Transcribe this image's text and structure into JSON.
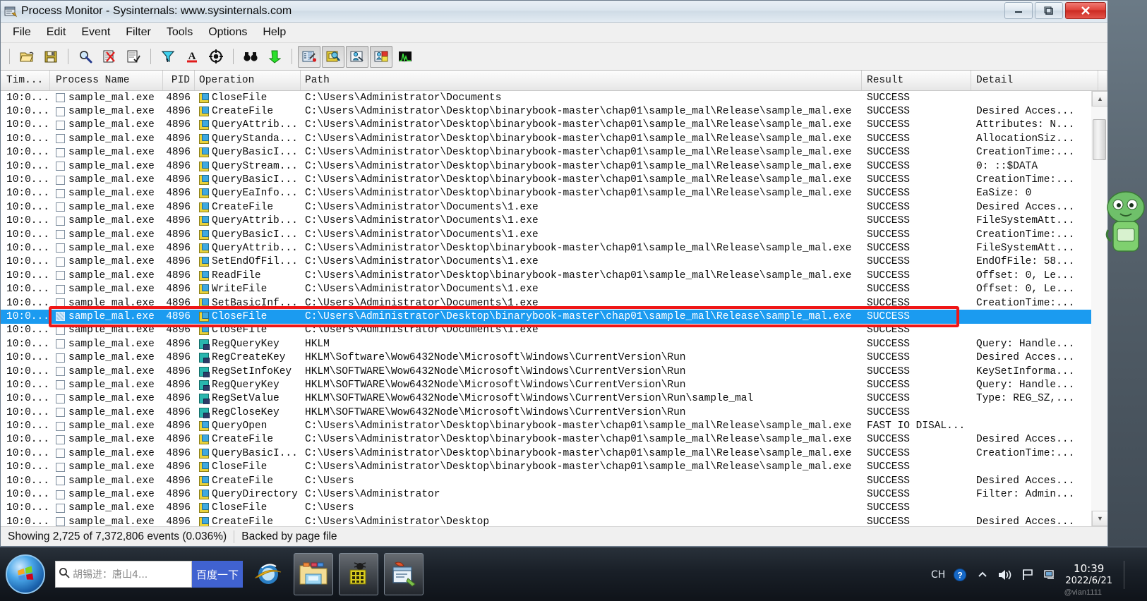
{
  "window": {
    "title": "Process Monitor - Sysinternals: www.sysinternals.com",
    "icon": "procmon-icon",
    "minimize": "–",
    "maximize": "❐",
    "close": "✕"
  },
  "menubar": [
    {
      "label": "File"
    },
    {
      "label": "Edit"
    },
    {
      "label": "Event"
    },
    {
      "label": "Filter"
    },
    {
      "label": "Tools"
    },
    {
      "label": "Options"
    },
    {
      "label": "Help"
    }
  ],
  "toolbar": [
    {
      "name": "open-icon",
      "pressed": false
    },
    {
      "name": "save-icon",
      "pressed": false
    },
    {
      "name": "separator"
    },
    {
      "name": "capture-events-icon",
      "pressed": false
    },
    {
      "name": "autoscroll-icon",
      "pressed": false
    },
    {
      "name": "clear-display-icon",
      "pressed": false
    },
    {
      "name": "separator"
    },
    {
      "name": "filter-icon",
      "pressed": false
    },
    {
      "name": "highlight-icon",
      "pressed": false
    },
    {
      "name": "include-process-icon",
      "pressed": false
    },
    {
      "name": "separator"
    },
    {
      "name": "find-icon",
      "pressed": false
    },
    {
      "name": "jump-to-icon",
      "pressed": false
    },
    {
      "name": "separator"
    },
    {
      "name": "show-registry-activity-icon",
      "pressed": true
    },
    {
      "name": "show-file-activity-icon",
      "pressed": true
    },
    {
      "name": "show-network-activity-icon",
      "pressed": true
    },
    {
      "name": "show-process-activity-icon",
      "pressed": true
    },
    {
      "name": "show-profiling-events-icon",
      "pressed": false
    }
  ],
  "columns": [
    {
      "key": "time",
      "label": "Tim..."
    },
    {
      "key": "process",
      "label": "Process Name"
    },
    {
      "key": "pid",
      "label": "PID"
    },
    {
      "key": "operation",
      "label": "Operation"
    },
    {
      "key": "path",
      "label": "Path"
    },
    {
      "key": "result",
      "label": "Result"
    },
    {
      "key": "detail",
      "label": "Detail"
    }
  ],
  "selected_row_index": 16,
  "highlight_color": "#ef1616",
  "selection_color": "#1b9bf0",
  "rows": [
    {
      "time": "10:0...",
      "process": "sample_mal.exe",
      "pid": "4896",
      "op_icon": "file",
      "operation": "CloseFile",
      "path": "C:\\Users\\Administrator\\Documents",
      "result": "SUCCESS",
      "detail": ""
    },
    {
      "time": "10:0...",
      "process": "sample_mal.exe",
      "pid": "4896",
      "op_icon": "file",
      "operation": "CreateFile",
      "path": "C:\\Users\\Administrator\\Desktop\\binarybook-master\\chap01\\sample_mal\\Release\\sample_mal.exe",
      "result": "SUCCESS",
      "detail": "Desired Acces..."
    },
    {
      "time": "10:0...",
      "process": "sample_mal.exe",
      "pid": "4896",
      "op_icon": "file",
      "operation": "QueryAttrib...",
      "path": "C:\\Users\\Administrator\\Desktop\\binarybook-master\\chap01\\sample_mal\\Release\\sample_mal.exe",
      "result": "SUCCESS",
      "detail": "Attributes: N..."
    },
    {
      "time": "10:0...",
      "process": "sample_mal.exe",
      "pid": "4896",
      "op_icon": "file",
      "operation": "QueryStanda...",
      "path": "C:\\Users\\Administrator\\Desktop\\binarybook-master\\chap01\\sample_mal\\Release\\sample_mal.exe",
      "result": "SUCCESS",
      "detail": "AllocationSiz..."
    },
    {
      "time": "10:0...",
      "process": "sample_mal.exe",
      "pid": "4896",
      "op_icon": "file",
      "operation": "QueryBasicI...",
      "path": "C:\\Users\\Administrator\\Desktop\\binarybook-master\\chap01\\sample_mal\\Release\\sample_mal.exe",
      "result": "SUCCESS",
      "detail": "CreationTime:..."
    },
    {
      "time": "10:0...",
      "process": "sample_mal.exe",
      "pid": "4896",
      "op_icon": "file",
      "operation": "QueryStream...",
      "path": "C:\\Users\\Administrator\\Desktop\\binarybook-master\\chap01\\sample_mal\\Release\\sample_mal.exe",
      "result": "SUCCESS",
      "detail": "0: ::$DATA"
    },
    {
      "time": "10:0...",
      "process": "sample_mal.exe",
      "pid": "4896",
      "op_icon": "file",
      "operation": "QueryBasicI...",
      "path": "C:\\Users\\Administrator\\Desktop\\binarybook-master\\chap01\\sample_mal\\Release\\sample_mal.exe",
      "result": "SUCCESS",
      "detail": "CreationTime:..."
    },
    {
      "time": "10:0...",
      "process": "sample_mal.exe",
      "pid": "4896",
      "op_icon": "file",
      "operation": "QueryEaInfo...",
      "path": "C:\\Users\\Administrator\\Desktop\\binarybook-master\\chap01\\sample_mal\\Release\\sample_mal.exe",
      "result": "SUCCESS",
      "detail": "EaSize: 0"
    },
    {
      "time": "10:0...",
      "process": "sample_mal.exe",
      "pid": "4896",
      "op_icon": "file",
      "operation": "CreateFile",
      "path": "C:\\Users\\Administrator\\Documents\\1.exe",
      "result": "SUCCESS",
      "detail": "Desired Acces..."
    },
    {
      "time": "10:0...",
      "process": "sample_mal.exe",
      "pid": "4896",
      "op_icon": "file",
      "operation": "QueryAttrib...",
      "path": "C:\\Users\\Administrator\\Documents\\1.exe",
      "result": "SUCCESS",
      "detail": "FileSystemAtt..."
    },
    {
      "time": "10:0...",
      "process": "sample_mal.exe",
      "pid": "4896",
      "op_icon": "file",
      "operation": "QueryBasicI...",
      "path": "C:\\Users\\Administrator\\Documents\\1.exe",
      "result": "SUCCESS",
      "detail": "CreationTime:..."
    },
    {
      "time": "10:0...",
      "process": "sample_mal.exe",
      "pid": "4896",
      "op_icon": "file",
      "operation": "QueryAttrib...",
      "path": "C:\\Users\\Administrator\\Desktop\\binarybook-master\\chap01\\sample_mal\\Release\\sample_mal.exe",
      "result": "SUCCESS",
      "detail": "FileSystemAtt..."
    },
    {
      "time": "10:0...",
      "process": "sample_mal.exe",
      "pid": "4896",
      "op_icon": "file",
      "operation": "SetEndOfFil...",
      "path": "C:\\Users\\Administrator\\Documents\\1.exe",
      "result": "SUCCESS",
      "detail": "EndOfFile: 58..."
    },
    {
      "time": "10:0...",
      "process": "sample_mal.exe",
      "pid": "4896",
      "op_icon": "file",
      "operation": "ReadFile",
      "path": "C:\\Users\\Administrator\\Desktop\\binarybook-master\\chap01\\sample_mal\\Release\\sample_mal.exe",
      "result": "SUCCESS",
      "detail": "Offset: 0, Le..."
    },
    {
      "time": "10:0...",
      "process": "sample_mal.exe",
      "pid": "4896",
      "op_icon": "file",
      "operation": "WriteFile",
      "path": "C:\\Users\\Administrator\\Documents\\1.exe",
      "result": "SUCCESS",
      "detail": "Offset: 0, Le..."
    },
    {
      "time": "10:0...",
      "process": "sample_mal.exe",
      "pid": "4896",
      "op_icon": "file",
      "operation": "SetBasicInf...",
      "path": "C:\\Users\\Administrator\\Documents\\1.exe",
      "result": "SUCCESS",
      "detail": "CreationTime:..."
    },
    {
      "time": "10:0...",
      "process": "sample_mal.exe",
      "pid": "4896",
      "op_icon": "file",
      "operation": "CloseFile",
      "path": "C:\\Users\\Administrator\\Desktop\\binarybook-master\\chap01\\sample_mal\\Release\\sample_mal.exe",
      "result": "SUCCESS",
      "detail": ""
    },
    {
      "time": "10:0...",
      "process": "sample_mal.exe",
      "pid": "4896",
      "op_icon": "file",
      "operation": "CloseFile",
      "path": "C:\\Users\\Administrator\\Documents\\1.exe",
      "result": "SUCCESS",
      "detail": ""
    },
    {
      "time": "10:0...",
      "process": "sample_mal.exe",
      "pid": "4896",
      "op_icon": "reg",
      "operation": "RegQueryKey",
      "path": "HKLM",
      "result": "SUCCESS",
      "detail": "Query: Handle..."
    },
    {
      "time": "10:0...",
      "process": "sample_mal.exe",
      "pid": "4896",
      "op_icon": "reg",
      "operation": "RegCreateKey",
      "path": "HKLM\\Software\\Wow6432Node\\Microsoft\\Windows\\CurrentVersion\\Run",
      "result": "SUCCESS",
      "detail": "Desired Acces..."
    },
    {
      "time": "10:0...",
      "process": "sample_mal.exe",
      "pid": "4896",
      "op_icon": "reg",
      "operation": "RegSetInfoKey",
      "path": "HKLM\\SOFTWARE\\Wow6432Node\\Microsoft\\Windows\\CurrentVersion\\Run",
      "result": "SUCCESS",
      "detail": "KeySetInforma..."
    },
    {
      "time": "10:0...",
      "process": "sample_mal.exe",
      "pid": "4896",
      "op_icon": "reg",
      "operation": "RegQueryKey",
      "path": "HKLM\\SOFTWARE\\Wow6432Node\\Microsoft\\Windows\\CurrentVersion\\Run",
      "result": "SUCCESS",
      "detail": "Query: Handle..."
    },
    {
      "time": "10:0...",
      "process": "sample_mal.exe",
      "pid": "4896",
      "op_icon": "reg",
      "operation": "RegSetValue",
      "path": "HKLM\\SOFTWARE\\Wow6432Node\\Microsoft\\Windows\\CurrentVersion\\Run\\sample_mal",
      "result": "SUCCESS",
      "detail": "Type: REG_SZ,..."
    },
    {
      "time": "10:0...",
      "process": "sample_mal.exe",
      "pid": "4896",
      "op_icon": "reg",
      "operation": "RegCloseKey",
      "path": "HKLM\\SOFTWARE\\Wow6432Node\\Microsoft\\Windows\\CurrentVersion\\Run",
      "result": "SUCCESS",
      "detail": ""
    },
    {
      "time": "10:0...",
      "process": "sample_mal.exe",
      "pid": "4896",
      "op_icon": "file",
      "operation": "QueryOpen",
      "path": "C:\\Users\\Administrator\\Desktop\\binarybook-master\\chap01\\sample_mal\\Release\\sample_mal.exe",
      "result": "FAST IO DISAL...",
      "detail": ""
    },
    {
      "time": "10:0...",
      "process": "sample_mal.exe",
      "pid": "4896",
      "op_icon": "file",
      "operation": "CreateFile",
      "path": "C:\\Users\\Administrator\\Desktop\\binarybook-master\\chap01\\sample_mal\\Release\\sample_mal.exe",
      "result": "SUCCESS",
      "detail": "Desired Acces..."
    },
    {
      "time": "10:0...",
      "process": "sample_mal.exe",
      "pid": "4896",
      "op_icon": "file",
      "operation": "QueryBasicI...",
      "path": "C:\\Users\\Administrator\\Desktop\\binarybook-master\\chap01\\sample_mal\\Release\\sample_mal.exe",
      "result": "SUCCESS",
      "detail": "CreationTime:..."
    },
    {
      "time": "10:0...",
      "process": "sample_mal.exe",
      "pid": "4896",
      "op_icon": "file",
      "operation": "CloseFile",
      "path": "C:\\Users\\Administrator\\Desktop\\binarybook-master\\chap01\\sample_mal\\Release\\sample_mal.exe",
      "result": "SUCCESS",
      "detail": ""
    },
    {
      "time": "10:0...",
      "process": "sample_mal.exe",
      "pid": "4896",
      "op_icon": "file",
      "operation": "CreateFile",
      "path": "C:\\Users",
      "result": "SUCCESS",
      "detail": "Desired Acces..."
    },
    {
      "time": "10:0...",
      "process": "sample_mal.exe",
      "pid": "4896",
      "op_icon": "file",
      "operation": "QueryDirectory",
      "path": "C:\\Users\\Administrator",
      "result": "SUCCESS",
      "detail": "Filter: Admin..."
    },
    {
      "time": "10:0...",
      "process": "sample_mal.exe",
      "pid": "4896",
      "op_icon": "file",
      "operation": "CloseFile",
      "path": "C:\\Users",
      "result": "SUCCESS",
      "detail": ""
    },
    {
      "time": "10:0...",
      "process": "sample_mal.exe",
      "pid": "4896",
      "op_icon": "file",
      "operation": "CreateFile",
      "path": "C:\\Users\\Administrator\\Desktop",
      "result": "SUCCESS",
      "detail": "Desired Acces..."
    }
  ],
  "statusbar": {
    "events": "Showing 2,725 of 7,372,806 events (0.036%)",
    "backing": "Backed by page file"
  },
  "taskbar": {
    "start": "start-orb",
    "search": {
      "icon": "search-icon",
      "value": "胡锡进：唐山4...",
      "button": "百度一下"
    },
    "apps": [
      {
        "name": "internet-explorer-icon",
        "framed": false
      },
      {
        "name": "windows-explorer-icon",
        "framed": true
      },
      {
        "name": "sample-mal-icon",
        "framed": true
      },
      {
        "name": "process-monitor-icon",
        "framed": true
      }
    ],
    "tray": {
      "ime": "CH",
      "help": "?",
      "volume": "volume-icon",
      "flag": "action-center-icon",
      "network": "network-icon",
      "time": "10:39",
      "date": "2022/6/21"
    },
    "watermark": "@vian1111"
  }
}
